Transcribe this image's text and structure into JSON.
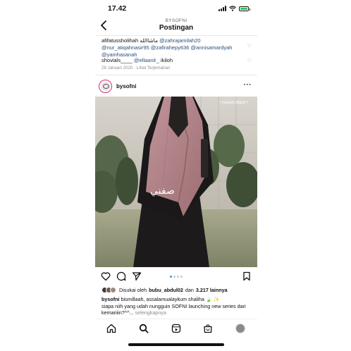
{
  "status_bar": {
    "time": "17.42"
  },
  "header": {
    "account": "BYSOFNI",
    "title": "Postingan"
  },
  "comments": [
    {
      "user": "afifatussholihah",
      "text_arabic": "ماشاالله",
      "mentions": "@zahrajamilah20 @nur_atiqahnasir95 @zafirahepy636 @annisamardyah @yamhasanah"
    },
    {
      "user": "shovials____",
      "mentions": "@ellaanlr_",
      "text": "ikiloh"
    }
  ],
  "comment_meta": {
    "date": "28 Januari 2020",
    "separator": "·",
    "translate": "Lihat Terjemahan"
  },
  "post": {
    "username": "bysofni",
    "more": "···",
    "image_overlay": {
      "label": "• mauve black •",
      "logo_text": "صفني"
    },
    "likes": {
      "prefix": "Disukai oleh",
      "user": "bubu_abdul02",
      "joiner": "dan",
      "count": "3.217 lainnya"
    },
    "caption": {
      "user": "bysofni",
      "line1": "bismillaah, assalamualaykum shaliha 🍃 ✨",
      "line2": "siapa niih yang udah nungguin SOFNI launching new series dari kemariiin?^^...",
      "more": "selengkapnya"
    }
  },
  "icons": {
    "status": [
      "signal-icon",
      "wifi-icon",
      "battery-icon"
    ],
    "actions": [
      "heart-icon",
      "comment-icon",
      "share-icon",
      "bookmark-icon"
    ],
    "tabs": [
      "home-icon",
      "search-icon",
      "reels-icon",
      "shop-icon",
      "profile-avatar"
    ]
  },
  "colors": {
    "accent_blue": "#3897f0",
    "battery_green": "#34c759",
    "mention_blue": "#2b4f7a",
    "garment_mauve": "#b7868a"
  }
}
